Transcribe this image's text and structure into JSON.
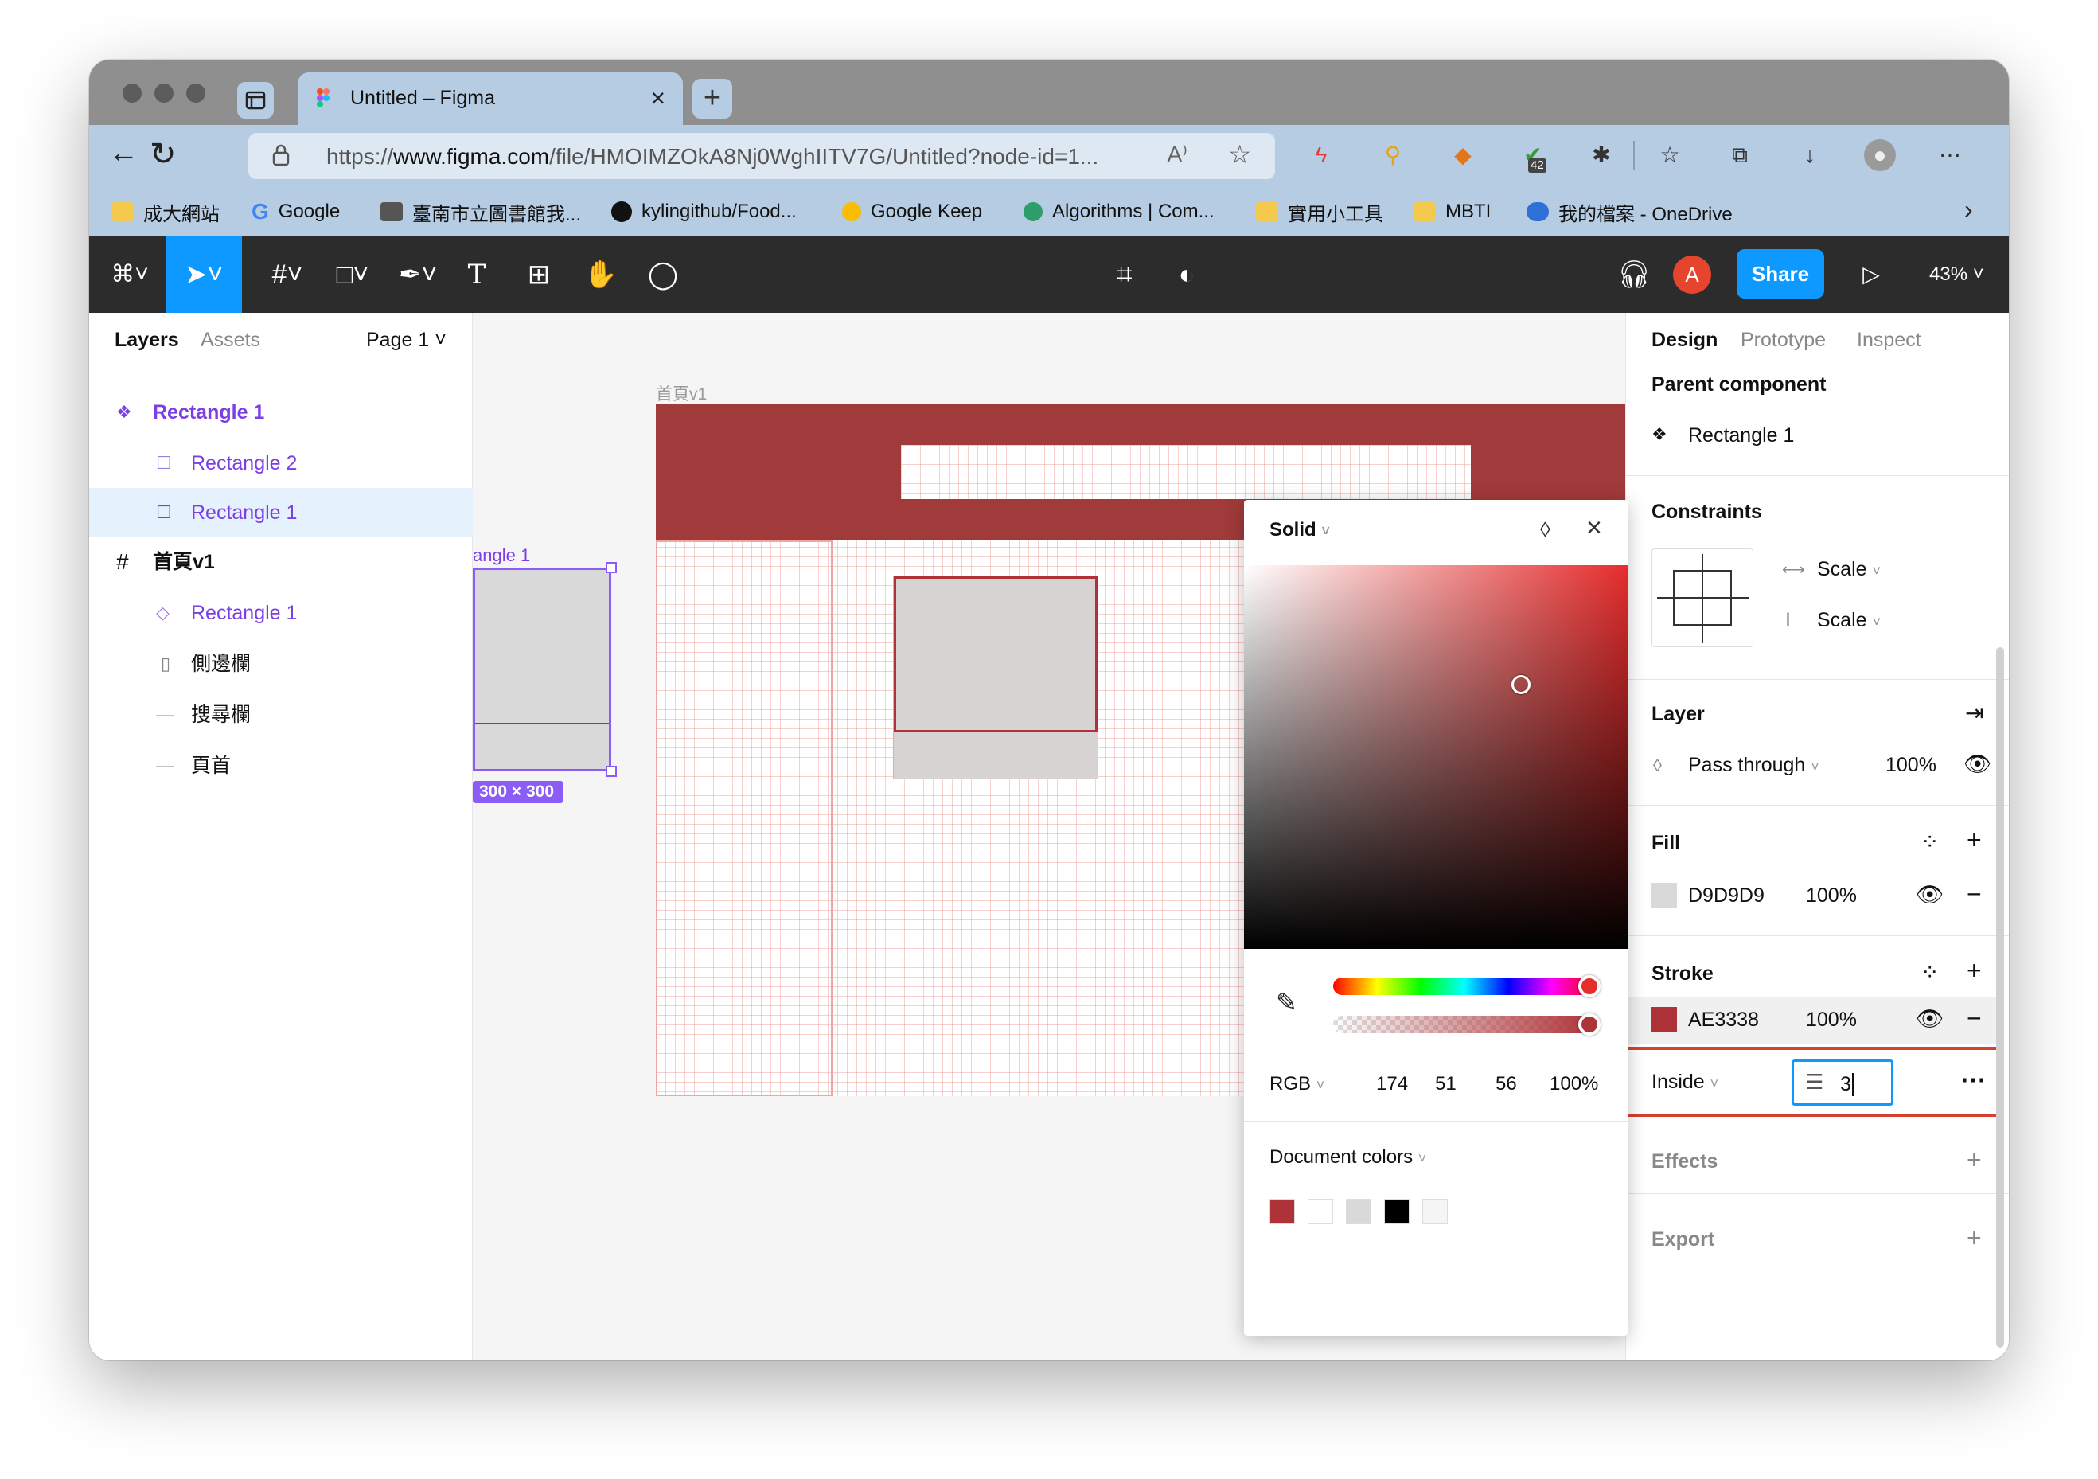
{
  "browser": {
    "tab_title": "Untitled – Figma",
    "new_tab_label": "+",
    "url_scheme": "https://",
    "url_domain": "www.figma.com",
    "url_path": "/file/HMOIMZOkA8Nj0WghIITV7G/Untitled?node-id=1...",
    "read_aloud_label": "A⁾",
    "extension_badge": "42",
    "bookmarks": [
      "成大網站",
      "Google",
      "臺南市立圖書館我...",
      "kylingithub/Food...",
      "Google Keep",
      "Algorithms | Com...",
      "實用小工具",
      "MBTI",
      "我的檔案 - OneDrive"
    ]
  },
  "figma": {
    "toolbar": {
      "share_label": "Share",
      "zoom": "43%",
      "avatar_initial": "A"
    },
    "left_panel": {
      "tabs": [
        "Layers",
        "Assets"
      ],
      "page": "Page 1",
      "layers": [
        {
          "name": "Rectangle 1",
          "color": "#7b3fe4"
        },
        {
          "name": "Rectangle 2",
          "color": "#7b3fe4"
        },
        {
          "name": "Rectangle 1",
          "color": "#7b3fe4"
        },
        {
          "name": "首頁v1",
          "color": "#111111"
        },
        {
          "name": "Rectangle 1",
          "color": "#7b3fe4"
        },
        {
          "name": "側邊欄",
          "color": "#111111"
        },
        {
          "name": "搜尋欄",
          "color": "#111111"
        },
        {
          "name": "頁首",
          "color": "#111111"
        }
      ]
    },
    "canvas": {
      "frame_label": "首頁v1",
      "selection_label": "angle 1",
      "size_badge": "300 × 300",
      "brand_color": "#a13a3a"
    },
    "color_picker": {
      "mode": "Solid",
      "color_model": "RGB",
      "r": "174",
      "g": "51",
      "b": "56",
      "alpha": "100%",
      "document_colors_label": "Document colors",
      "document_colors": [
        "#ae3338",
        "#ffffff",
        "#d9d9d9",
        "#000000",
        "#f5f5f5"
      ]
    },
    "right_panel": {
      "tabs": [
        "Design",
        "Prototype",
        "Inspect"
      ],
      "parent_component_label": "Parent component",
      "parent_component": "Rectangle 1",
      "constraints_label": "Constraints",
      "constraint_h": "Scale",
      "constraint_v": "Scale",
      "layer_label": "Layer",
      "blend_mode": "Pass through",
      "layer_opacity": "100%",
      "fill_label": "Fill",
      "fill_hex": "D9D9D9",
      "fill_opacity": "100%",
      "fill_color": "#d9d9d9",
      "stroke_label": "Stroke",
      "stroke_hex": "AE3338",
      "stroke_opacity": "100%",
      "stroke_color": "#ae3338",
      "stroke_position": "Inside",
      "stroke_weight": "3",
      "effects_label": "Effects",
      "export_label": "Export",
      "help_label": "?"
    }
  }
}
